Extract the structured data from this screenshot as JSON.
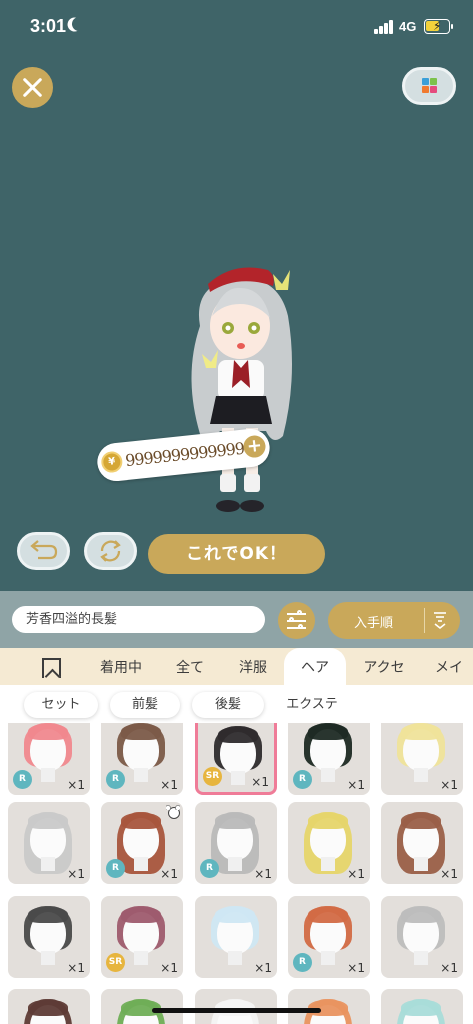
{
  "status_bar": {
    "time": "3:01",
    "network": "4G",
    "battery_color": "#f3d23b"
  },
  "top_controls": {
    "close_icon": "close-icon",
    "palette_icon": "color-palette-icon"
  },
  "avatar": {
    "price": "99999999999999",
    "coin_icon": "coin-icon",
    "add_icon": "plus-icon"
  },
  "actions": {
    "undo_icon": "undo-icon",
    "refresh_icon": "refresh-icon",
    "ok_label": "これでOK！"
  },
  "filters": {
    "item_name": "芳香四溢的長髪",
    "filter_icon": "sliders-icon",
    "sort_label": "入手順",
    "sort_icon": "sort-order-icon"
  },
  "tabs": [
    {
      "label": "着用中"
    },
    {
      "label": "全て"
    },
    {
      "label": "洋服"
    },
    {
      "label": "ヘア",
      "active": true
    },
    {
      "label": "アクセ"
    },
    {
      "label": "メイ"
    }
  ],
  "subtabs": [
    {
      "label": "セット"
    },
    {
      "label": "前髪"
    },
    {
      "label": "後髪"
    },
    {
      "label": "エクステ"
    }
  ],
  "items": [
    {
      "rarity": "R",
      "count": "×1",
      "hair": "#f0888e"
    },
    {
      "rarity": "R",
      "count": "×1",
      "hair": "#7b5a48"
    },
    {
      "rarity": "SR",
      "count": "×1",
      "hair": "#2e2b2d",
      "selected": true
    },
    {
      "rarity": "R",
      "count": "×1",
      "hair": "#1e2a24"
    },
    {
      "rarity": "",
      "count": "×1",
      "hair": "#efe39a"
    },
    {
      "rarity": "",
      "count": "×1",
      "hair": "#c9c9c9"
    },
    {
      "rarity": "R",
      "count": "×1",
      "hair": "#a8553d",
      "bear": true
    },
    {
      "rarity": "R",
      "count": "×1",
      "hair": "#b9b9b9"
    },
    {
      "rarity": "",
      "count": "×1",
      "hair": "#e6d56a"
    },
    {
      "rarity": "",
      "count": "×1",
      "hair": "#9a5f48"
    },
    {
      "rarity": "",
      "count": "×1",
      "hair": "#4a4a4a"
    },
    {
      "rarity": "SR",
      "count": "×1",
      "hair": "#9e5b6e"
    },
    {
      "rarity": "",
      "count": "×1",
      "hair": "#cfe7f3"
    },
    {
      "rarity": "R",
      "count": "×1",
      "hair": "#d26a45"
    },
    {
      "rarity": "",
      "count": "×1",
      "hair": "#bdbdbd"
    },
    {
      "rarity": "",
      "count": "",
      "hair": "#5e3b36"
    },
    {
      "rarity": "",
      "count": "",
      "hair": "#6fae56"
    },
    {
      "rarity": "",
      "count": "",
      "hair": "#f4f4f4"
    },
    {
      "rarity": "",
      "count": "",
      "hair": "#e99360"
    },
    {
      "rarity": "",
      "count": "",
      "hair": "#a9dcd9"
    }
  ]
}
